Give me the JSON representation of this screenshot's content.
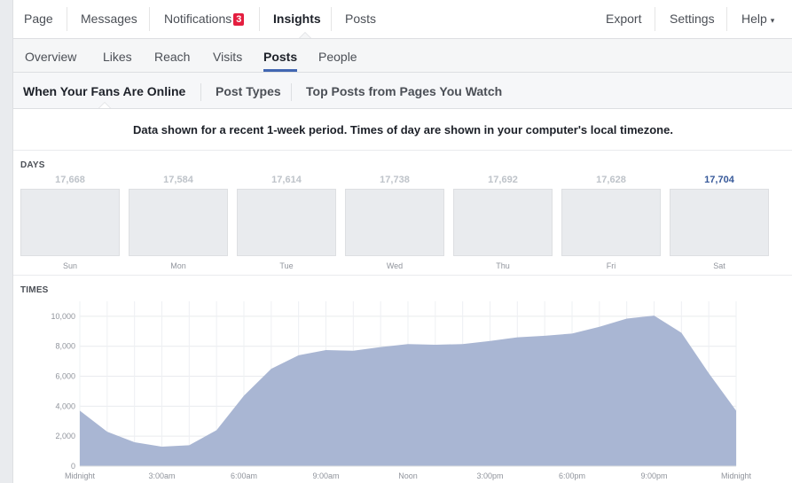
{
  "top_nav": {
    "page": "Page",
    "messages": "Messages",
    "notifications": "Notifications",
    "notifications_count": "3",
    "insights": "Insights",
    "posts": "Posts",
    "export": "Export",
    "settings": "Settings",
    "help": "Help",
    "help_caret": "▾"
  },
  "sub_nav": {
    "overview": "Overview",
    "likes": "Likes",
    "reach": "Reach",
    "visits": "Visits",
    "posts": "Posts",
    "people": "People"
  },
  "section_tabs": {
    "fans_online": "When Your Fans Are Online",
    "post_types": "Post Types",
    "top_posts": "Top Posts from Pages You Watch"
  },
  "info_text": "Data shown for a recent 1-week period. Times of day are shown in your computer's local timezone.",
  "days": {
    "label": "DAYS",
    "items": [
      {
        "day": "Sun",
        "value": "17,668"
      },
      {
        "day": "Mon",
        "value": "17,584"
      },
      {
        "day": "Tue",
        "value": "17,614"
      },
      {
        "day": "Wed",
        "value": "17,738"
      },
      {
        "day": "Thu",
        "value": "17,692"
      },
      {
        "day": "Fri",
        "value": "17,628"
      },
      {
        "day": "Sat",
        "value": "17,704"
      }
    ],
    "highlighted": "Sat"
  },
  "times": {
    "label": "TIMES"
  },
  "colors": {
    "area_fill": "#a9b6d3",
    "highlight": "#365899",
    "badge": "#e41e3f",
    "tab_underline": "#4267b2"
  },
  "chart_data": {
    "type": "area",
    "title": "",
    "xlabel": "",
    "ylabel": "",
    "x_ticks": [
      "Midnight",
      "3:00am",
      "6:00am",
      "9:00am",
      "Noon",
      "3:00pm",
      "6:00pm",
      "9:00pm",
      "Midnight"
    ],
    "y_ticks": [
      "0",
      "2,000",
      "4,000",
      "6,000",
      "8,000",
      "10,000"
    ],
    "ylim": [
      0,
      11000
    ],
    "grid": true,
    "x": [
      0,
      1,
      2,
      3,
      4,
      5,
      6,
      7,
      8,
      9,
      10,
      11,
      12,
      13,
      14,
      15,
      16,
      17,
      18,
      19,
      20,
      21,
      22,
      23,
      24
    ],
    "values": [
      3700,
      2300,
      1600,
      1300,
      1400,
      2400,
      4700,
      6500,
      7400,
      7750,
      7700,
      7950,
      8150,
      8100,
      8150,
      8350,
      8600,
      8700,
      8850,
      9300,
      9850,
      10050,
      8900,
      6200,
      3700
    ]
  }
}
